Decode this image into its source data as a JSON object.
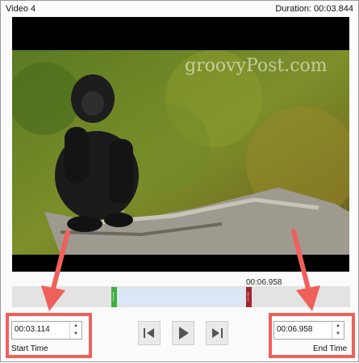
{
  "window": {
    "title": "Video 4",
    "duration_label": "Duration: 00:03.844"
  },
  "video": {
    "watermark": "groovyPost.com"
  },
  "timeline": {
    "end_marker_label": "00:06.958"
  },
  "start_time": {
    "value": "00:03.114",
    "label": "Start Time"
  },
  "end_time": {
    "value": "00:06.958",
    "label": "End Time"
  },
  "icons": {
    "previous": "previous-frame-icon",
    "play": "play-icon",
    "next": "next-frame-icon",
    "spin_up": "chevron-up-icon",
    "spin_down": "chevron-down-icon"
  },
  "colors": {
    "highlight": "#f0605b",
    "start_handle": "#3fb03f",
    "end_handle": "#a5252d",
    "trim_region": "#dbe7f7"
  }
}
